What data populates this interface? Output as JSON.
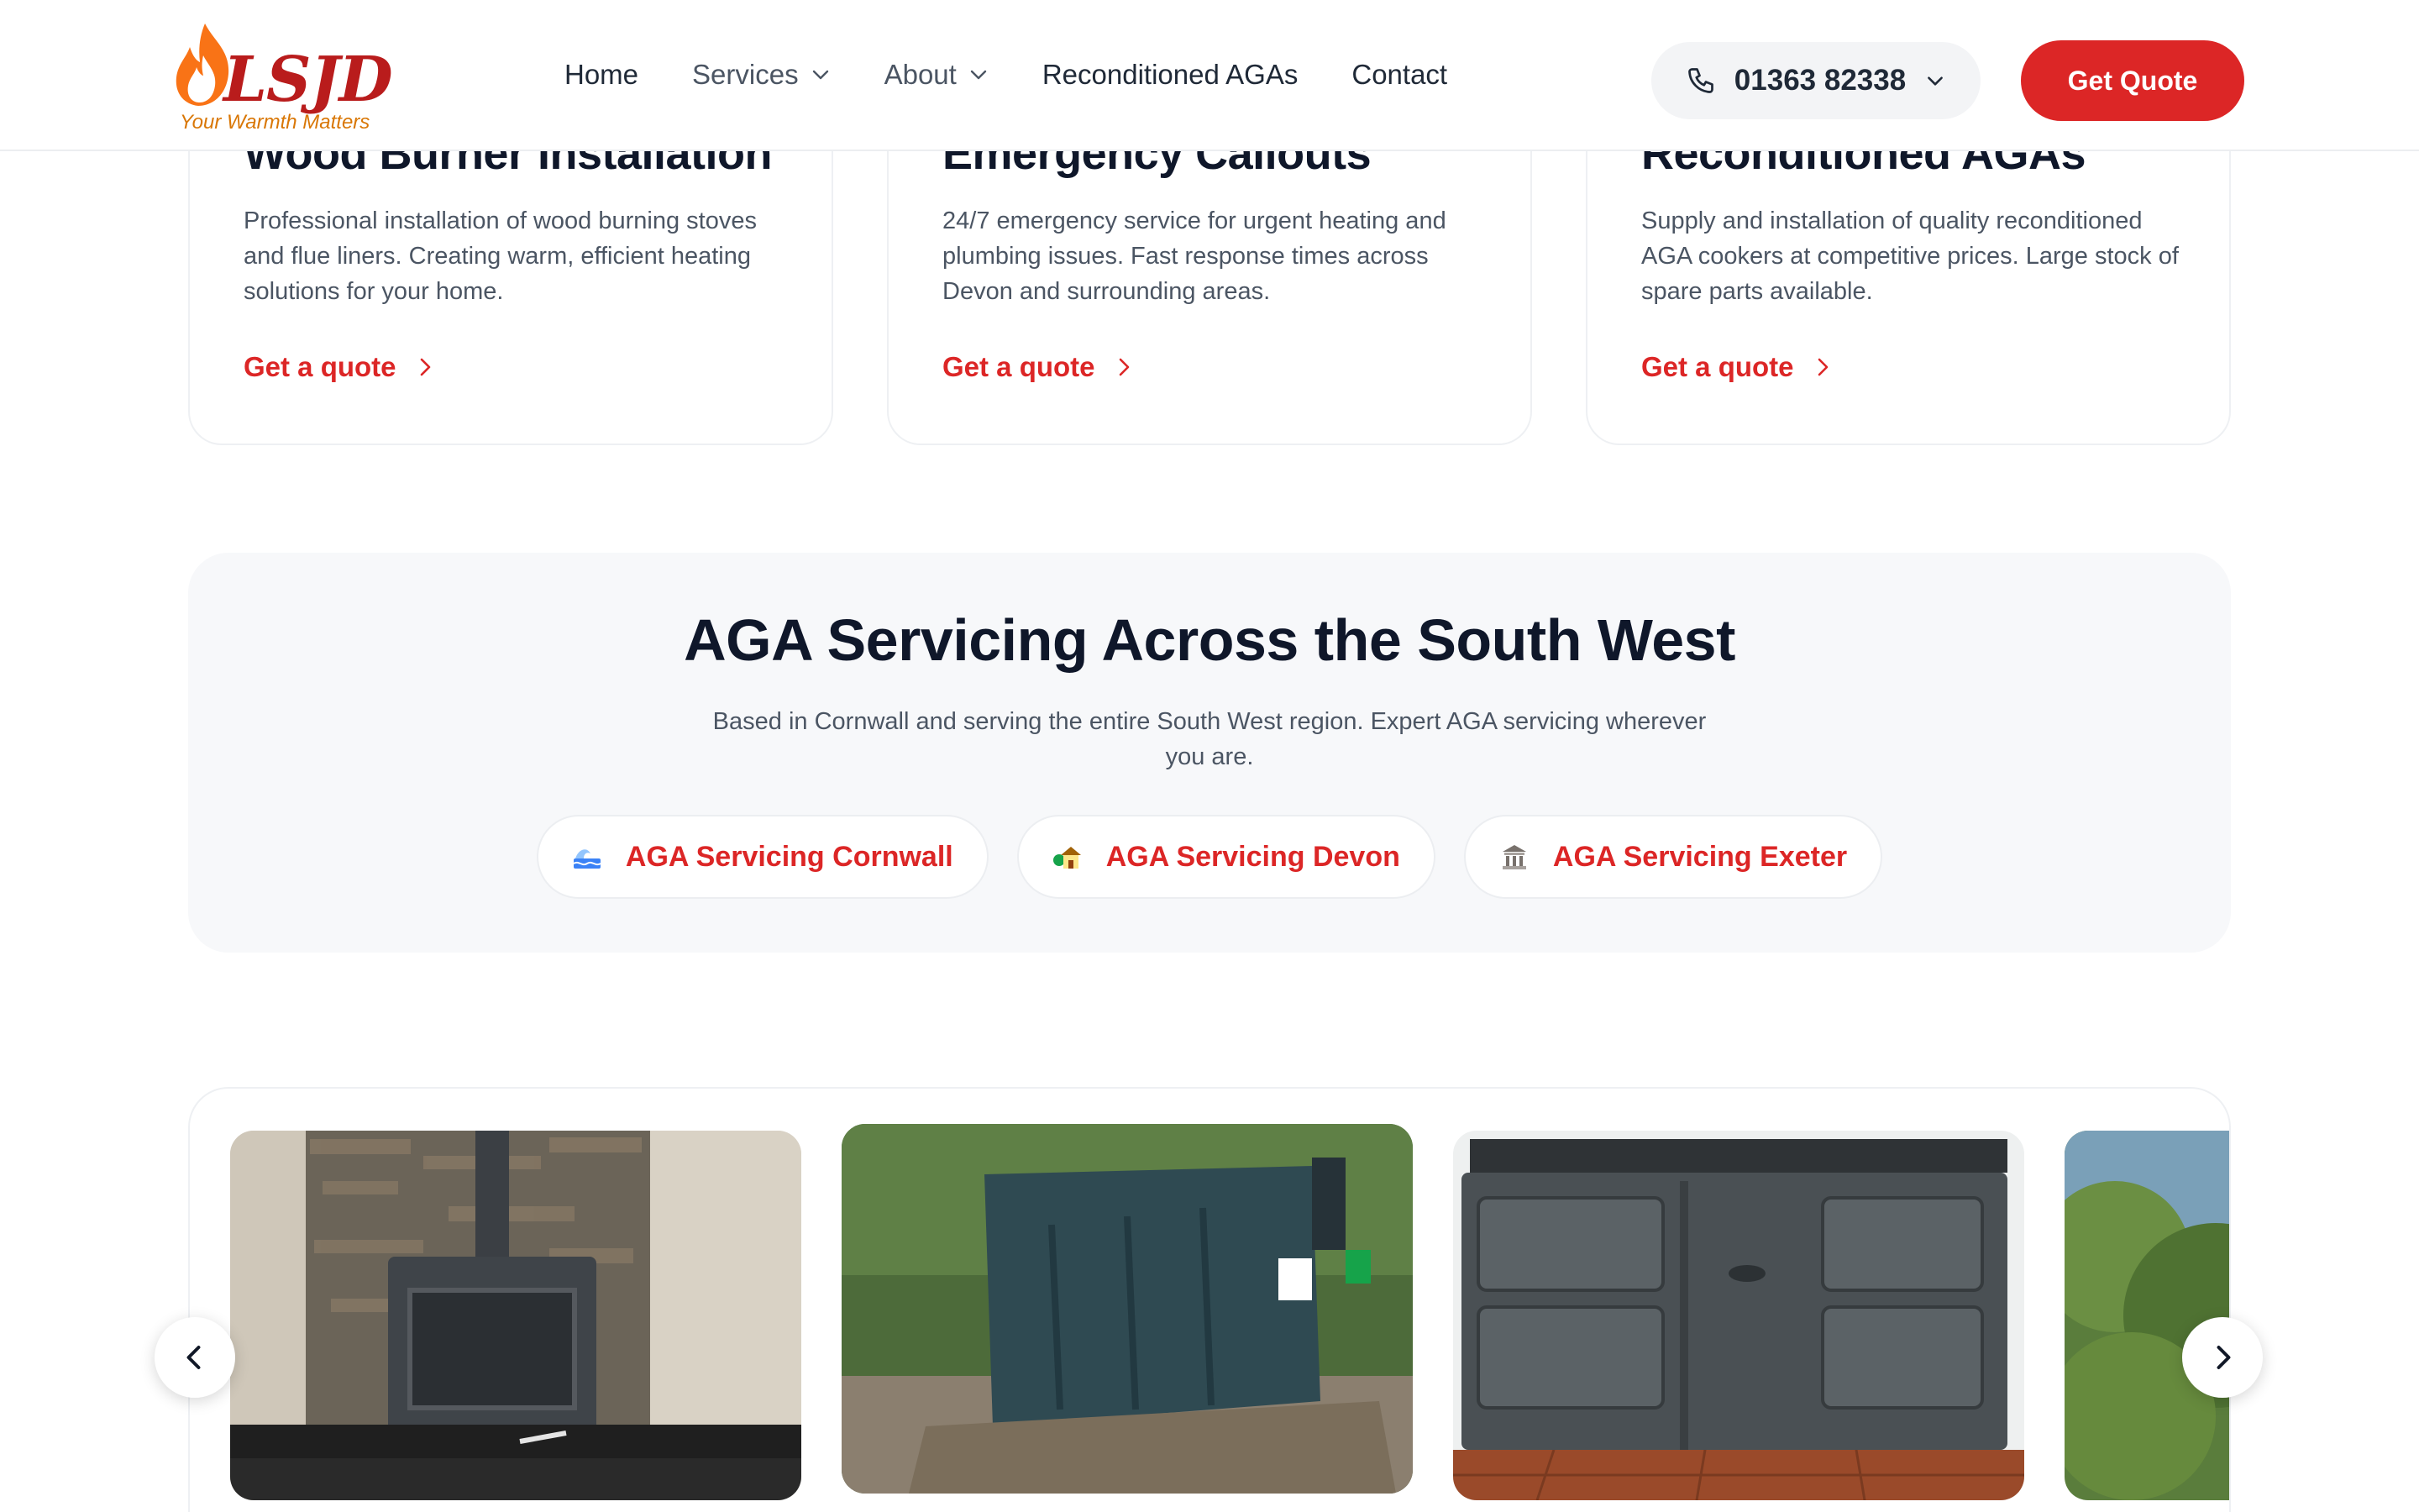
{
  "header": {
    "logo_text": "LSJD",
    "logo_tagline": "Your Warmth Matters",
    "nav": [
      {
        "label": "Home"
      },
      {
        "label": "Services"
      },
      {
        "label": "About"
      },
      {
        "label": "Reconditioned AGAs"
      },
      {
        "label": "Contact"
      }
    ],
    "phone": "01363 82338",
    "cta": "Get Quote"
  },
  "services": [
    {
      "title": "Wood Burner Installation",
      "description": "Professional installation of wood burning stoves and flue liners. Creating warm, efficient heating solutions for your home.",
      "link": "Get a quote"
    },
    {
      "title": "Emergency Callouts",
      "description": "24/7 emergency service for urgent heating and plumbing issues. Fast response times across Devon and surrounding areas.",
      "link": "Get a quote"
    },
    {
      "title": "Reconditioned AGAs",
      "description": "Supply and installation of quality reconditioned AGA cookers at competitive prices. Large stock of spare parts available.",
      "link": "Get a quote"
    }
  ],
  "regions": {
    "title": "AGA Servicing Across the South West",
    "description": "Based in Cornwall and serving the entire South West region. Expert AGA servicing wherever you are.",
    "links": [
      {
        "label": "AGA Servicing Cornwall",
        "icon": "wave-icon"
      },
      {
        "label": "AGA Servicing Devon",
        "icon": "cottage-icon"
      },
      {
        "label": "AGA Servicing Exeter",
        "icon": "cathedral-icon"
      }
    ]
  },
  "gallery": {
    "photos": [
      {
        "subject": "wood-burner-stove-photo"
      },
      {
        "subject": "oil-tank-photo"
      },
      {
        "subject": "aga-cooker-photo"
      },
      {
        "subject": "garden-photo"
      }
    ]
  },
  "colors": {
    "accent": "#dc2626",
    "text": "#0f172a",
    "muted": "#4b5563",
    "panel": "#f7f8fa"
  }
}
